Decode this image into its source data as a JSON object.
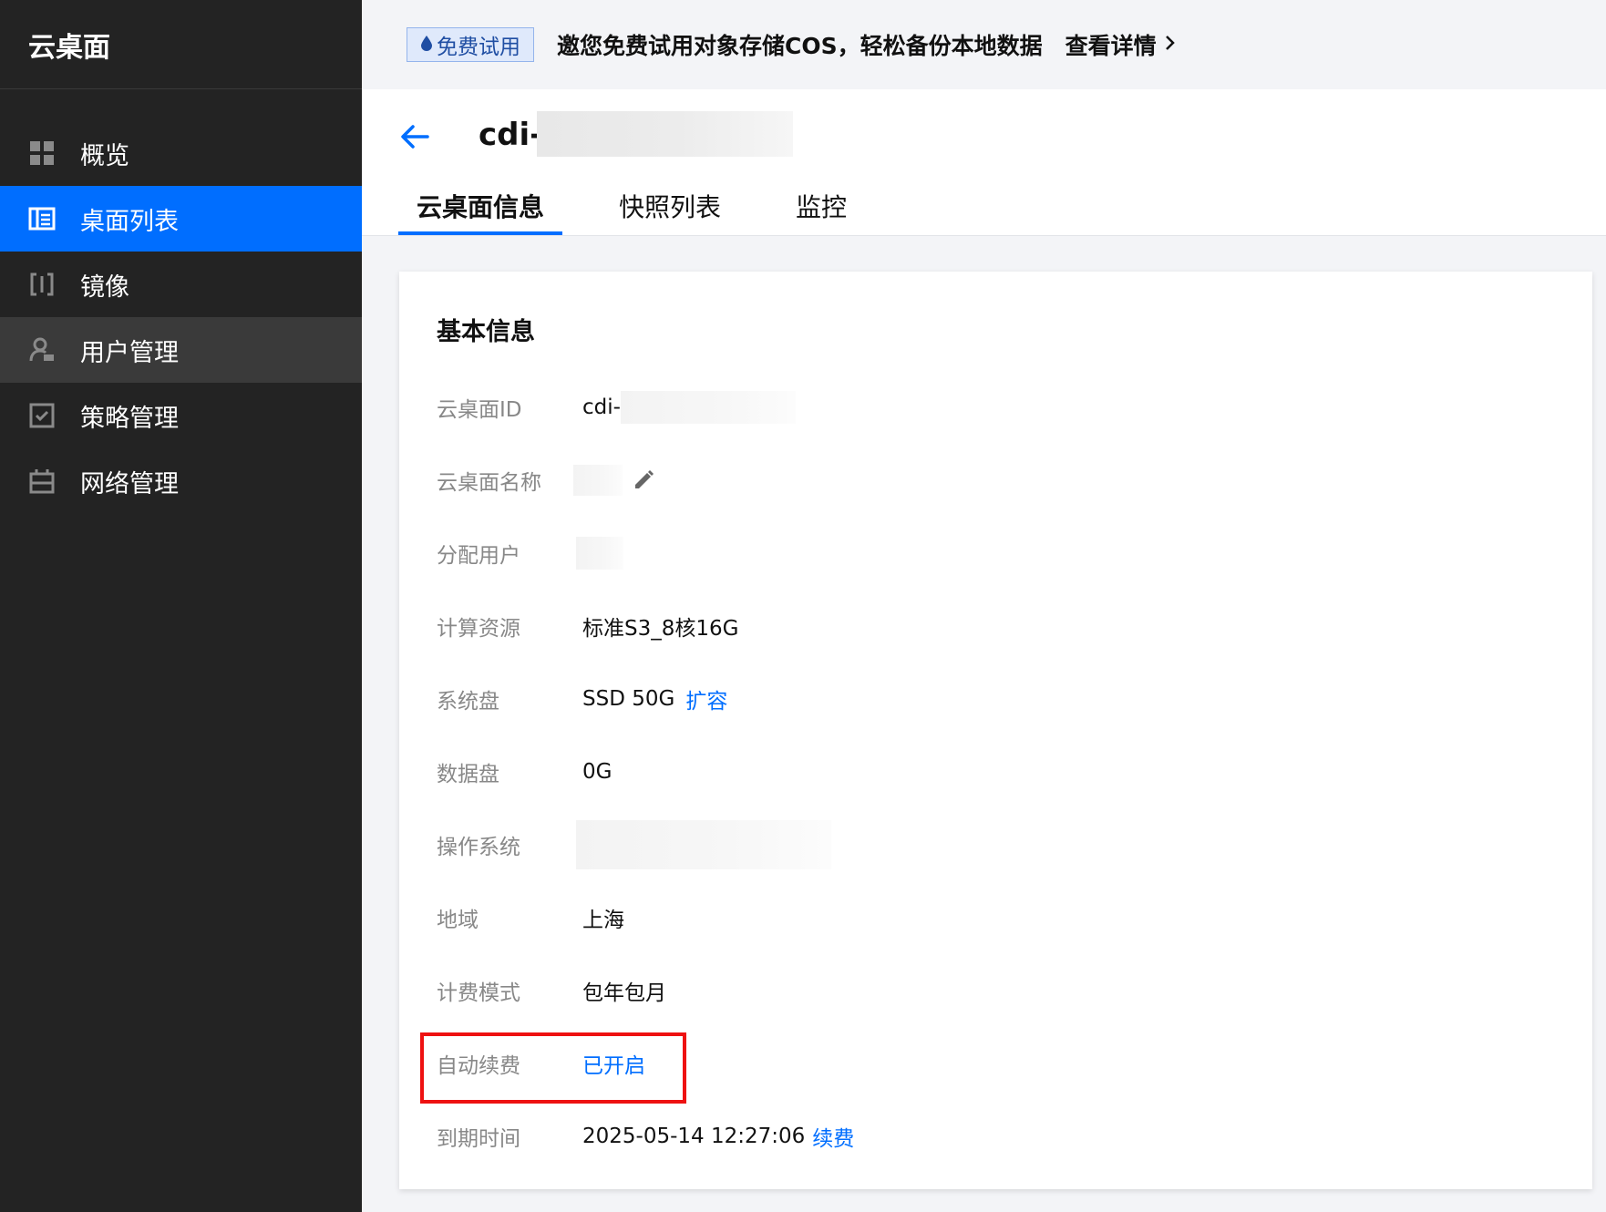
{
  "sidebar": {
    "brand": "云桌面",
    "items": [
      {
        "label": "概览",
        "icon": "grid-icon"
      },
      {
        "label": "桌面列表",
        "icon": "desktop-list-icon",
        "active": true
      },
      {
        "label": "镜像",
        "icon": "image-icon"
      },
      {
        "label": "用户管理",
        "icon": "user-icon"
      },
      {
        "label": "策略管理",
        "icon": "policy-icon"
      },
      {
        "label": "网络管理",
        "icon": "network-icon"
      }
    ]
  },
  "banner": {
    "tag": "免费试用",
    "text": "邀您免费试用对象存储COS，轻松备份本地数据",
    "link": "查看详情"
  },
  "header": {
    "title": "cdi-",
    "tabs": [
      "云桌面信息",
      "快照列表",
      "监控"
    ]
  },
  "card": {
    "title": "基本信息",
    "rows": {
      "id": {
        "label": "云桌面ID",
        "value": "cdi-"
      },
      "name": {
        "label": "云桌面名称"
      },
      "user": {
        "label": "分配用户"
      },
      "compute": {
        "label": "计算资源",
        "value": "标准S3_8核16G"
      },
      "sysdisk": {
        "label": "系统盘",
        "value": "SSD 50G",
        "action": "扩容"
      },
      "datadisk": {
        "label": "数据盘",
        "value": "0G"
      },
      "os": {
        "label": "操作系统"
      },
      "region": {
        "label": "地域",
        "value": "上海"
      },
      "billing": {
        "label": "计费模式",
        "value": "包年包月"
      },
      "autorenew": {
        "label": "自动续费",
        "value": "已开启"
      },
      "expire": {
        "label": "到期时间",
        "value": "2025-05-14 12:27:06",
        "action": "续费"
      }
    }
  },
  "colors": {
    "accent": "#006eff",
    "sidebar": "#232323",
    "highlight": "#ee1111"
  }
}
